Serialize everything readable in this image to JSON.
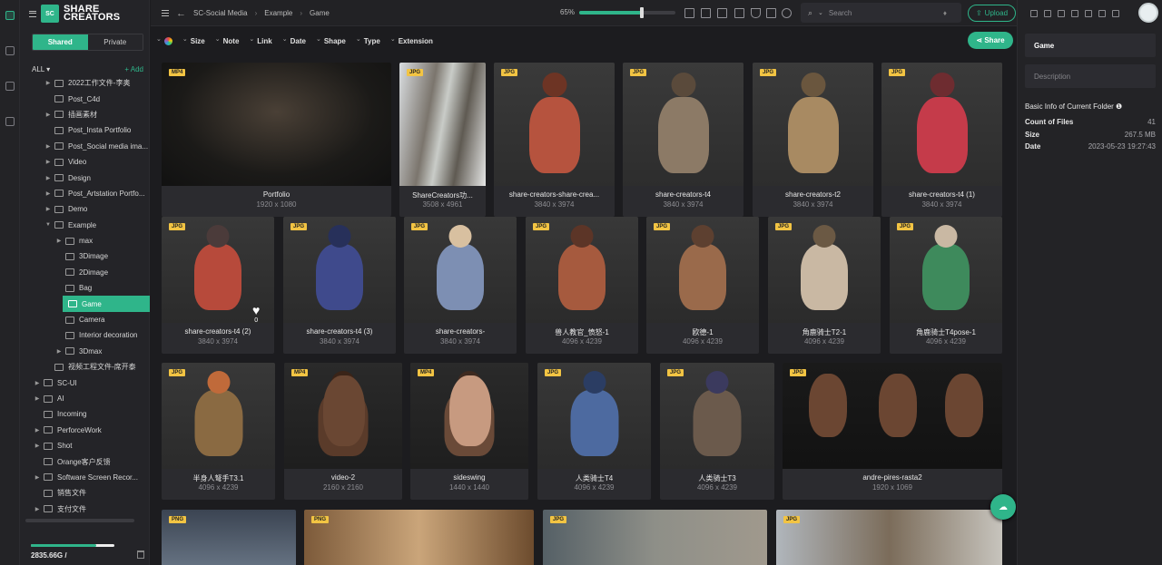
{
  "app": {
    "logo_line1": "SHARE",
    "logo_line2": "CREATORS",
    "logo_mark": "SC"
  },
  "sidebar": {
    "scope_tabs": [
      "Shared",
      "Private"
    ],
    "all_label": "ALL ▾",
    "add_label": "+ Add",
    "tree": [
      {
        "label": "2022工作文件-李奥",
        "indent": 1,
        "caret": true
      },
      {
        "label": "Post_C4d",
        "indent": 1,
        "caret": false
      },
      {
        "label": "插画素材",
        "indent": 1,
        "caret": true
      },
      {
        "label": "Post_Insta Portfolio",
        "indent": 1,
        "caret": false
      },
      {
        "label": "Post_Social media ima...",
        "indent": 1,
        "caret": true
      },
      {
        "label": "Video",
        "indent": 1,
        "caret": true
      },
      {
        "label": "Design",
        "indent": 1,
        "caret": true
      },
      {
        "label": "Post_Artstation Portfo...",
        "indent": 1,
        "caret": true
      },
      {
        "label": "Demo",
        "indent": 1,
        "caret": true
      },
      {
        "label": "Example",
        "indent": 1,
        "caret": true,
        "open": true
      },
      {
        "label": "max",
        "indent": 2,
        "caret": true
      },
      {
        "label": "3Dimage",
        "indent": 2,
        "caret": false
      },
      {
        "label": "2Dimage",
        "indent": 2,
        "caret": false
      },
      {
        "label": "Bag",
        "indent": 2,
        "caret": false
      },
      {
        "label": "Game",
        "indent": 2,
        "caret": false,
        "selected": true
      },
      {
        "label": "Camera",
        "indent": 2,
        "caret": false
      },
      {
        "label": "Interior decoration",
        "indent": 2,
        "caret": false
      },
      {
        "label": "3Dmax",
        "indent": 2,
        "caret": true
      },
      {
        "label": "视频工程文件-席开泰",
        "indent": 1,
        "caret": false
      },
      {
        "label": "SC-UI",
        "indent": 0,
        "caret": true
      },
      {
        "label": "AI",
        "indent": 0,
        "caret": true
      },
      {
        "label": "Incoming",
        "indent": 0,
        "caret": false
      },
      {
        "label": "PerforceWork",
        "indent": 0,
        "caret": true
      },
      {
        "label": "Shot",
        "indent": 0,
        "caret": true
      },
      {
        "label": "Orange客户反馈",
        "indent": 0,
        "caret": false
      },
      {
        "label": "Software Screen Recor...",
        "indent": 0,
        "caret": true
      },
      {
        "label": "销售文件",
        "indent": 0,
        "caret": false
      },
      {
        "label": "支付文件",
        "indent": 0,
        "caret": true
      }
    ],
    "storage_text": "2835.66G /",
    "storage_fraction": 0.78
  },
  "topbar": {
    "breadcrumb": [
      "SC-Social Media",
      "Example",
      "Game"
    ],
    "zoom": "65%",
    "zoom_fraction": 0.65,
    "search_placeholder": "Search",
    "upload_label": "Upload"
  },
  "filters": {
    "items": [
      "Size",
      "Note",
      "Link",
      "Date",
      "Shape",
      "Type",
      "Extension"
    ],
    "share_label": "Share"
  },
  "cards": [
    {
      "name": "Portfolio",
      "dims": "1920 x 1080",
      "type": "MP4"
    },
    {
      "name": "ShareCreators功...",
      "dims": "3508 x 4961",
      "type": "JPG"
    },
    {
      "name": "share-creators-share-crea...",
      "dims": "3840 x 3974",
      "type": "JPG"
    },
    {
      "name": "share-creators-t4",
      "dims": "3840 x 3974",
      "type": "JPG"
    },
    {
      "name": "share-creators-t2",
      "dims": "3840 x 3974",
      "type": "JPG"
    },
    {
      "name": "share-creators-t4 (1)",
      "dims": "3840 x 3974",
      "type": "JPG"
    },
    {
      "name": "share-creators-t4 (2)",
      "dims": "3840 x 3974",
      "type": "JPG",
      "likes": "0"
    },
    {
      "name": "share-creators-t4 (3)",
      "dims": "3840 x 3974",
      "type": "JPG"
    },
    {
      "name": "share-creators-",
      "dims": "3840 x 3974",
      "type": "JPG"
    },
    {
      "name": "兽人教官_愤怒-1",
      "dims": "4096 x 4239",
      "type": "JPG"
    },
    {
      "name": "欧德-1",
      "dims": "4096 x 4239",
      "type": "JPG"
    },
    {
      "name": "角鹿骑士T2-1",
      "dims": "4096 x 4239",
      "type": "JPG"
    },
    {
      "name": "角鹿骑士T4pose-1",
      "dims": "4096 x 4239",
      "type": "JPG"
    },
    {
      "name": "半身人弩手T3.1",
      "dims": "4096 x 4239",
      "type": "JPG"
    },
    {
      "name": "video-2",
      "dims": "2160 x 2160",
      "type": "MP4"
    },
    {
      "name": "sideswing",
      "dims": "1440 x 1440",
      "type": "MP4"
    },
    {
      "name": "人类骑士T4",
      "dims": "4096 x 4239",
      "type": "JPG"
    },
    {
      "name": "人类骑士T3",
      "dims": "4096 x 4239",
      "type": "JPG"
    },
    {
      "name": "andre-pires-rasta2",
      "dims": "1920 x 1069",
      "type": "JPG"
    },
    {
      "name": "",
      "dims": "",
      "type": "PNG"
    },
    {
      "name": "",
      "dims": "",
      "type": "PNG"
    },
    {
      "name": "",
      "dims": "",
      "type": "JPG"
    },
    {
      "name": "",
      "dims": "",
      "type": "JPG"
    }
  ],
  "panel": {
    "folder_name": "Game",
    "description_placeholder": "Description",
    "info_title": "Basic Info of Current Folder ❶",
    "count_label": "Count of Files",
    "count_value": "41",
    "size_label": "Size",
    "size_value": "267.5 MB",
    "date_label": "Date",
    "date_value": "2023-05-23 19:27:43"
  },
  "colors": {
    "accent": "#2fb58a",
    "badge": "#f2c443",
    "bg": "#1c1c1f"
  }
}
